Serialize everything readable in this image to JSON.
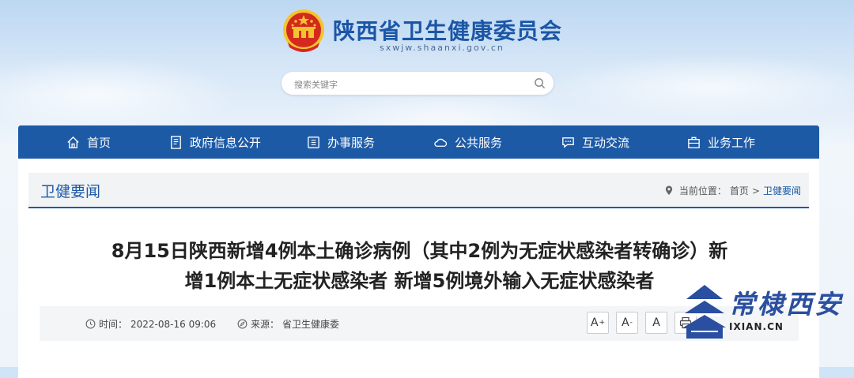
{
  "header": {
    "site_title": "陕西省卫生健康委员会",
    "site_domain": "sxwjw.shaanxi.gov.cn",
    "search_placeholder": "搜索关键字"
  },
  "nav": {
    "items": [
      {
        "label": "首页",
        "icon": "home-icon"
      },
      {
        "label": "政府信息公开",
        "icon": "document-icon"
      },
      {
        "label": "办事服务",
        "icon": "folder-icon"
      },
      {
        "label": "公共服务",
        "icon": "cloud-icon"
      },
      {
        "label": "互动交流",
        "icon": "chat-icon"
      },
      {
        "label": "业务工作",
        "icon": "briefcase-icon"
      }
    ]
  },
  "section": {
    "title": "卫健要闻",
    "location_label": "当前位置：",
    "breadcrumb": [
      "首页",
      "卫健要闻"
    ],
    "separator": ">"
  },
  "article": {
    "title_line1": "8月15日陕西新增4例本土确诊病例（其中2例为无症状感染者转确诊）新",
    "title_line2": "增1例本土无症状感染者 新增5例境外输入无症状感染者",
    "time_label": "时间：",
    "time_value": "2022-08-16 09:06",
    "source_label": "来源：",
    "source_value": "省卫生健康委"
  },
  "toolbar": {
    "font_larger": "A",
    "font_larger_sup": "+",
    "font_smaller": "A",
    "font_smaller_sup": "-",
    "font_reset": "A"
  },
  "watermark": {
    "text": "常棣西安",
    "url": "IXIAN.CN"
  },
  "colors": {
    "brand_blue": "#1d5aa6",
    "emblem_red": "#d42a1e",
    "emblem_gold": "#f4c430"
  }
}
